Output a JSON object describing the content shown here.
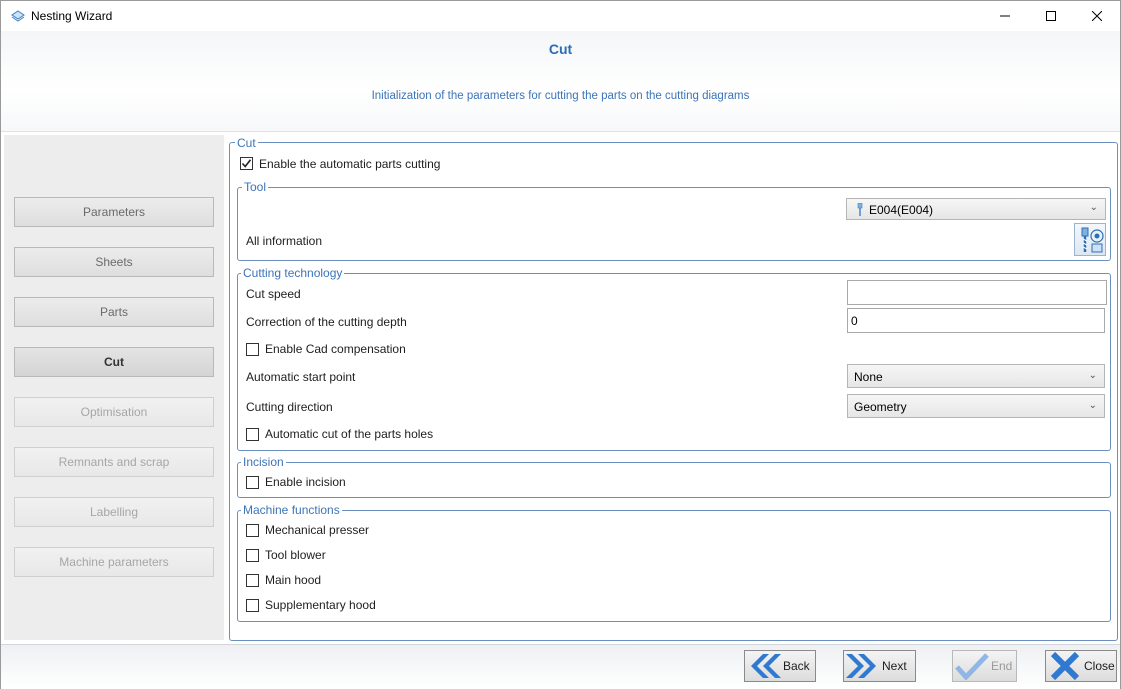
{
  "window": {
    "title": "Nesting Wizard",
    "icon": "nesting-icon",
    "controls": [
      "minimize-icon",
      "maximize-icon",
      "close-icon"
    ]
  },
  "header": {
    "title": "Cut",
    "subtitle": "Initialization of the parameters for cutting the parts on the cutting diagrams",
    "accent_color": "#2b6cb7"
  },
  "sidebar": {
    "items": [
      {
        "label": "Parameters",
        "state": "enabled"
      },
      {
        "label": "Sheets",
        "state": "enabled"
      },
      {
        "label": "Parts",
        "state": "enabled"
      },
      {
        "label": "Cut",
        "state": "active"
      },
      {
        "label": "Optimisation",
        "state": "disabled"
      },
      {
        "label": "Remnants and scrap",
        "state": "disabled"
      },
      {
        "label": "Labelling",
        "state": "disabled"
      },
      {
        "label": "Machine parameters",
        "state": "disabled"
      }
    ]
  },
  "cut": {
    "legend": "Cut",
    "enable_auto_cut": {
      "label": "Enable the automatic parts cutting",
      "checked": true
    },
    "tool": {
      "legend": "Tool",
      "selected": "E004(E004)",
      "selected_icon": "tool-bit-icon",
      "all_info_label": "All information",
      "info_button_icon": "tool-info-icon"
    },
    "technology": {
      "legend": "Cutting technology",
      "cut_speed_label": "Cut speed",
      "cut_speed_value": "",
      "depth_correction_label": "Correction of the cutting depth",
      "depth_correction_value": "0",
      "cad_compensation": {
        "label": "Enable Cad compensation",
        "checked": false
      },
      "start_point_label": "Automatic start point",
      "start_point_value": "None",
      "direction_label": "Cutting direction",
      "direction_value": "Geometry",
      "auto_holes": {
        "label": "Automatic cut of the parts holes",
        "checked": false
      }
    },
    "incision": {
      "legend": "Incision",
      "enable": {
        "label": "Enable incision",
        "checked": false
      }
    },
    "machine_functions": {
      "legend": "Machine functions",
      "items": [
        {
          "label": "Mechanical presser",
          "checked": false
        },
        {
          "label": "Tool blower",
          "checked": false
        },
        {
          "label": "Main hood",
          "checked": false
        },
        {
          "label": "Supplementary hood",
          "checked": false
        }
      ]
    }
  },
  "footer": {
    "back": {
      "label": "Back",
      "icon": "back-arrows-icon",
      "enabled": true
    },
    "next": {
      "label": "Next",
      "icon": "next-arrows-icon",
      "enabled": true
    },
    "end": {
      "label": "End",
      "icon": "checkmark-icon",
      "enabled": false
    },
    "close": {
      "label": "Close",
      "icon": "x-close-icon",
      "enabled": true
    }
  }
}
